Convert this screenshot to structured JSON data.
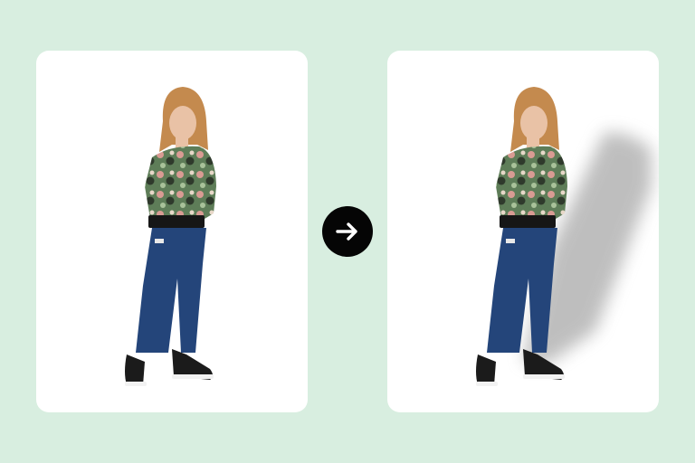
{
  "before_card": {
    "image": "girl-in-camouflage-sweater-and-jeans",
    "background": "#ffffff"
  },
  "after_card": {
    "image": "girl-in-camouflage-sweater-and-jeans-with-drop-shadow",
    "background": "#ffffff"
  },
  "arrow": {
    "icon": "arrow-right-icon",
    "color": "#050505",
    "glyph_color": "#ffffff"
  },
  "colors": {
    "page_background": "#d8eee0",
    "hair": "#c48a4e",
    "skin": "#e9c2a6",
    "sweater_green": "#5e7d58",
    "sweater_pink": "#d99b93",
    "sweater_dark": "#2f3a2c",
    "jeans": "#24457a",
    "shoes": "#1b1b1b"
  }
}
